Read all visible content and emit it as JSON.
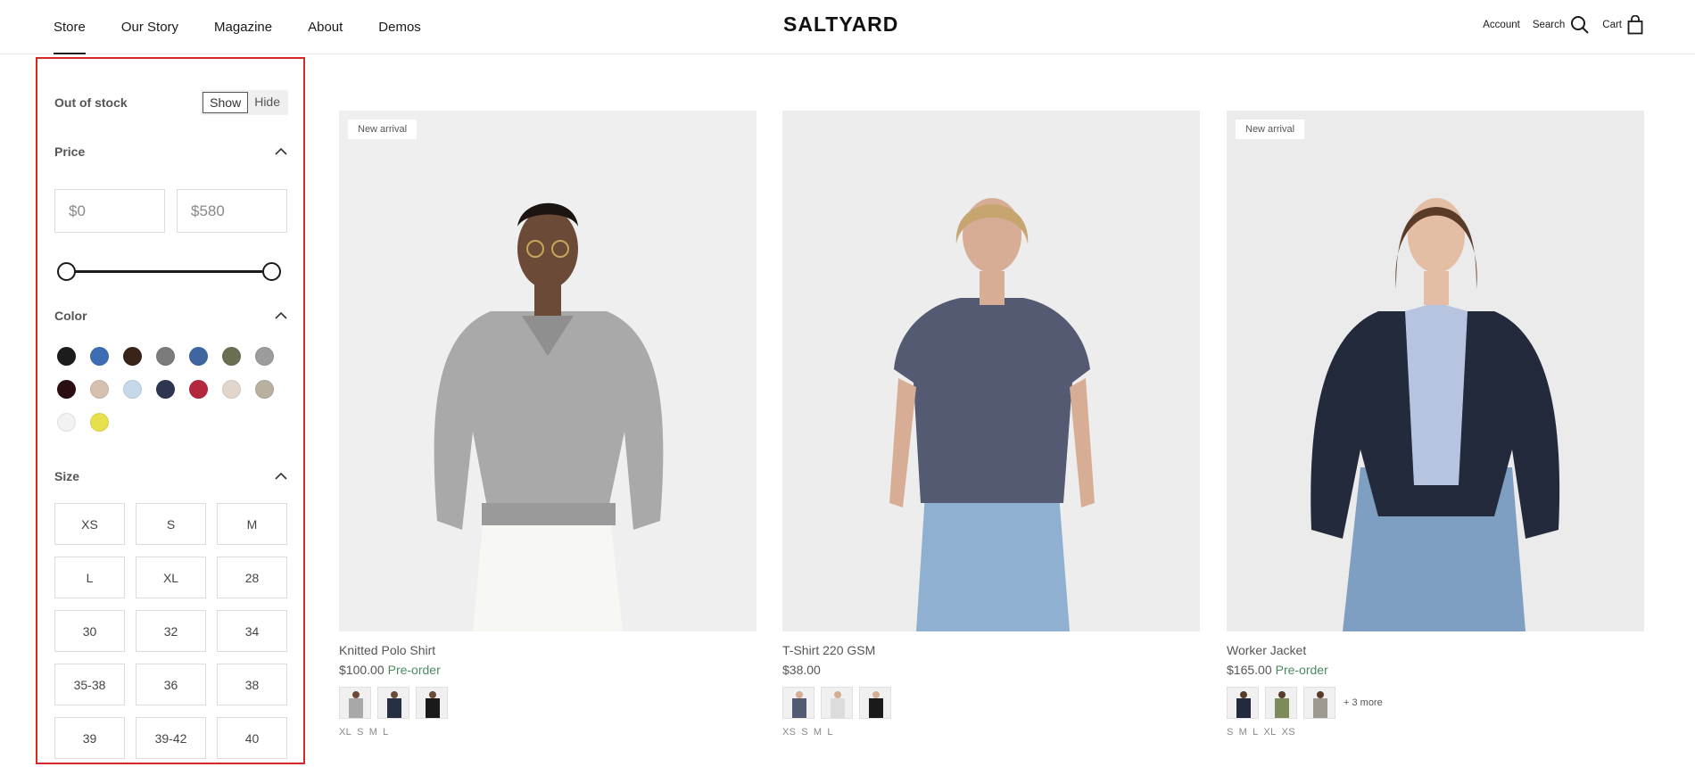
{
  "header": {
    "nav": [
      "Store",
      "Our Story",
      "Magazine",
      "About",
      "Demos"
    ],
    "logo": "SALTYARD",
    "account": "Account",
    "search": "Search",
    "cart": "Cart"
  },
  "filters": {
    "stock": {
      "label": "Out of stock",
      "show": "Show",
      "hide": "Hide",
      "selected": "Show"
    },
    "price": {
      "label": "Price",
      "min": "$0",
      "max": "$580",
      "range_min": 0,
      "range_max": 580
    },
    "color": {
      "label": "Color",
      "swatches": [
        "#1c1c1c",
        "#3e6db3",
        "#3a2418",
        "#7b7b7b",
        "#4066a2",
        "#6b6f52",
        "#9c9c9c",
        "#2a0e12",
        "#d6c1b1",
        "#c6d8ea",
        "#2d3550",
        "#b3283f",
        "#e2d6cc",
        "#b8b0a0",
        "#f2f2f2",
        "#e7e04d"
      ]
    },
    "size": {
      "label": "Size",
      "options": [
        "XS",
        "S",
        "M",
        "L",
        "XL",
        "28",
        "30",
        "32",
        "34",
        "35-38",
        "36",
        "38",
        "39",
        "39-42",
        "40"
      ]
    }
  },
  "products": [
    {
      "title": "Knitted Polo Shirt",
      "price": "$100.00",
      "preorder": "Pre-order",
      "badge": "New arrival",
      "sizes": [
        "XL",
        "S",
        "M",
        "L"
      ],
      "more": ""
    },
    {
      "title": "T-Shirt 220 GSM",
      "price": "$38.00",
      "preorder": "",
      "badge": "",
      "sizes": [
        "XS",
        "S",
        "M",
        "L"
      ],
      "more": ""
    },
    {
      "title": "Worker Jacket",
      "price": "$165.00",
      "preorder": "Pre-order",
      "badge": "New arrival",
      "sizes": [
        "S",
        "M",
        "L",
        "XL",
        "XS"
      ],
      "more": "+ 3 more"
    }
  ]
}
